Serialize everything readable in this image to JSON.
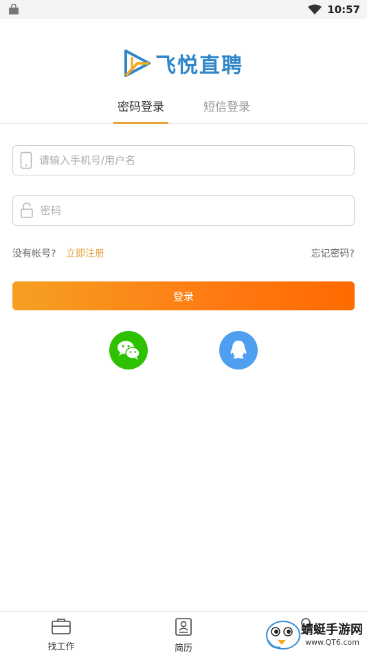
{
  "status_bar": {
    "time": "10:57"
  },
  "logo": {
    "text": "飞悦直聘"
  },
  "tabs": [
    {
      "label": "密码登录",
      "active": true
    },
    {
      "label": "短信登录",
      "active": false
    }
  ],
  "form": {
    "phone_placeholder": "请输入手机号/用户名",
    "password_placeholder": "密码"
  },
  "links": {
    "no_account": "没有帐号?",
    "register": "立即注册",
    "forgot": "忘记密码?"
  },
  "login_button": "登录",
  "social": [
    "wechat-icon",
    "qq-icon"
  ],
  "bottom_nav": [
    {
      "label": "找工作",
      "icon": "briefcase-icon"
    },
    {
      "label": "简历",
      "icon": "resume-icon"
    },
    {
      "label": "",
      "icon": "person-icon"
    }
  ],
  "watermark": {
    "text": "蜻蜓手游网",
    "url_text": "www.QT6.com"
  },
  "colors": {
    "accent": "#e6a23c",
    "brand_blue": "#2f86c9",
    "wechat": "#2dc100",
    "qq": "#4e9ff0",
    "button_start": "#f5a023",
    "button_end": "#ff6a00"
  }
}
